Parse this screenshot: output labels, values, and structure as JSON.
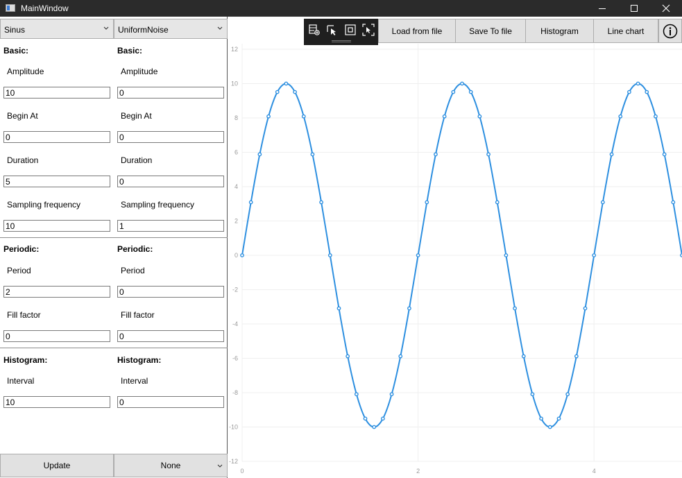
{
  "window": {
    "title": "MainWindow",
    "accent": "#2b2b2b"
  },
  "left": {
    "signal1": {
      "type": "Sinus",
      "basic_title": "Basic:",
      "amplitude_label": "Amplitude",
      "amplitude": "10",
      "begin_label": "Begin At",
      "begin": "0",
      "duration_label": "Duration",
      "duration": "5",
      "sampling_label": "Sampling frequency",
      "sampling": "10",
      "periodic_title": "Periodic:",
      "period_label": "Period",
      "period": "2",
      "fill_label": "Fill factor",
      "fill": "0",
      "histogram_title": "Histogram:",
      "interval_label": "Interval",
      "interval": "10"
    },
    "signal2": {
      "type": "UniformNoise",
      "basic_title": "Basic:",
      "amplitude_label": "Amplitude",
      "amplitude": "0",
      "begin_label": "Begin At",
      "begin": "0",
      "duration_label": "Duration",
      "duration": "0",
      "sampling_label": "Sampling frequency",
      "sampling": "1",
      "periodic_title": "Periodic:",
      "period_label": "Period",
      "period": "0",
      "fill_label": "Fill factor",
      "fill": "0",
      "histogram_title": "Histogram:",
      "interval_label": "Interval",
      "interval": "0"
    },
    "update_label": "Update",
    "operation": "None"
  },
  "toolbar": {
    "icons": [
      "zoom-table-icon",
      "select-pointer-icon",
      "fit-box-icon",
      "screenshot-icon"
    ],
    "load_label": "Load from file",
    "save_label": "Save To file",
    "histogram_label": "Histogram",
    "linechart_label": "Line chart",
    "info_icon": "info-icon"
  },
  "chart_data": {
    "type": "line",
    "title": "",
    "xlabel": "",
    "ylabel": "",
    "xlim": [
      0,
      5
    ],
    "ylim": [
      -12,
      12
    ],
    "x_ticks": [
      "0",
      "2",
      "4"
    ],
    "y_ticks": [
      "12",
      "10",
      "8",
      "6",
      "4",
      "2",
      "0",
      "-2",
      "-4",
      "-6",
      "-8",
      "-10",
      "-12"
    ],
    "grid": true,
    "series": [
      {
        "color": "#2d8fe0",
        "x": [
          0,
          0.1,
          0.2,
          0.3,
          0.4,
          0.5,
          0.6,
          0.7,
          0.8,
          0.9,
          1.0,
          1.1,
          1.2,
          1.3,
          1.4,
          1.5,
          1.6,
          1.7,
          1.8,
          1.9,
          2.0,
          2.1,
          2.2,
          2.3,
          2.4,
          2.5,
          2.6,
          2.7,
          2.8,
          2.9,
          3.0,
          3.1,
          3.2,
          3.3,
          3.4,
          3.5,
          3.6,
          3.7,
          3.8,
          3.9,
          4.0,
          4.1,
          4.2,
          4.3,
          4.4,
          4.5,
          4.6,
          4.7,
          4.8,
          4.9,
          5.0
        ],
        "values": [
          0,
          3.09,
          5.88,
          8.09,
          9.51,
          10,
          9.51,
          8.09,
          5.88,
          3.09,
          0,
          -3.09,
          -5.88,
          -8.09,
          -9.51,
          -10,
          -9.51,
          -8.09,
          -5.88,
          -3.09,
          0,
          3.09,
          5.88,
          8.09,
          9.51,
          10,
          9.51,
          8.09,
          5.88,
          3.09,
          0,
          -3.09,
          -5.88,
          -8.09,
          -9.51,
          -10,
          -9.51,
          -8.09,
          -5.88,
          -3.09,
          0,
          3.09,
          5.88,
          8.09,
          9.51,
          10,
          9.51,
          8.09,
          5.88,
          3.09,
          0
        ]
      }
    ]
  }
}
